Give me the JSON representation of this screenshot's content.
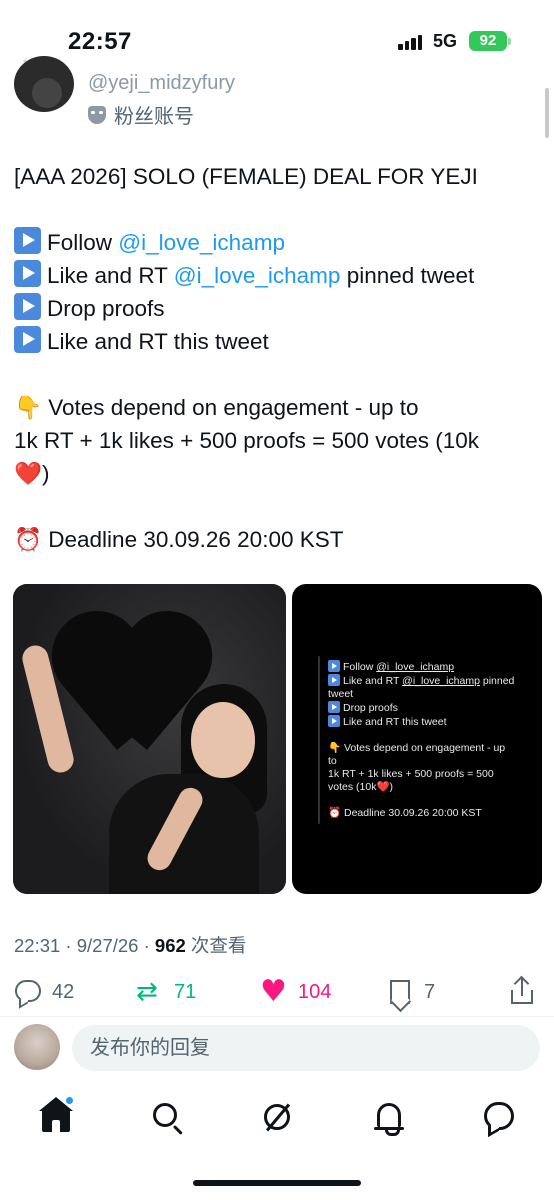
{
  "status_bar": {
    "time": "22:57",
    "network": "5G",
    "battery": "92"
  },
  "author": {
    "handle": "@yeji_midzyfury",
    "badge_label": "粉丝账号"
  },
  "tweet": {
    "title": "[AAA 2026] SOLO (FEMALE) DEAL FOR YEJI",
    "steps": [
      {
        "prefix": "Follow ",
        "link": "@i_love_ichamp",
        "suffix": ""
      },
      {
        "prefix": "Like and RT ",
        "link": "@i_love_ichamp",
        "suffix": " pinned tweet"
      },
      {
        "prefix": "Drop proofs",
        "link": "",
        "suffix": ""
      },
      {
        "prefix": "Like and RT this tweet",
        "link": "",
        "suffix": ""
      }
    ],
    "votes_line1": "Votes depend on engagement - up to",
    "votes_line2": "1k RT + 1k likes + 500 proofs = 500 votes (10k",
    "votes_line3": ")",
    "deadline": "Deadline 30.09.26 20:00 KST",
    "emojis": {
      "point_down": "👇",
      "heart": "❤️",
      "alarm": "⏰"
    }
  },
  "media_text": {
    "lines": [
      {
        "prefix": "Follow ",
        "link": "@i_love_ichamp",
        "suffix": ""
      },
      {
        "prefix": "Like and RT ",
        "link": "@i_love_ichamp",
        "suffix": " pinned"
      },
      {
        "prefix": "tweet",
        "link": "",
        "suffix": ""
      },
      {
        "prefix": "Drop proofs",
        "link": "",
        "suffix": ""
      },
      {
        "prefix": "Like and RT this tweet",
        "link": "",
        "suffix": ""
      }
    ],
    "votes_line1": "Votes depend on engagement - up",
    "votes_line2": "to",
    "votes_line3": "1k RT + 1k likes + 500 proofs = 500",
    "votes_line4": "votes (10k",
    "votes_line5": ")",
    "deadline": "Deadline 30.09.26 20:00 KST"
  },
  "meta": {
    "timestamp": "22:31 · 9/27/26 · ",
    "views_count": "962",
    "views_label": " 次查看"
  },
  "actions": {
    "replies": "42",
    "retweets": "71",
    "likes": "104",
    "bookmarks": "7"
  },
  "reply": {
    "placeholder": "发布你的回复"
  },
  "colors": {
    "link": "#1d9bf0",
    "retweet": "#00ba7c",
    "like": "#f91880",
    "battery": "#34c759"
  },
  "icons": {
    "nav": [
      "home-icon",
      "search-icon",
      "grok-icon",
      "notifications-icon",
      "messages-icon"
    ],
    "actions": [
      "reply-icon",
      "retweet-icon",
      "like-icon",
      "bookmark-icon",
      "share-icon"
    ]
  }
}
